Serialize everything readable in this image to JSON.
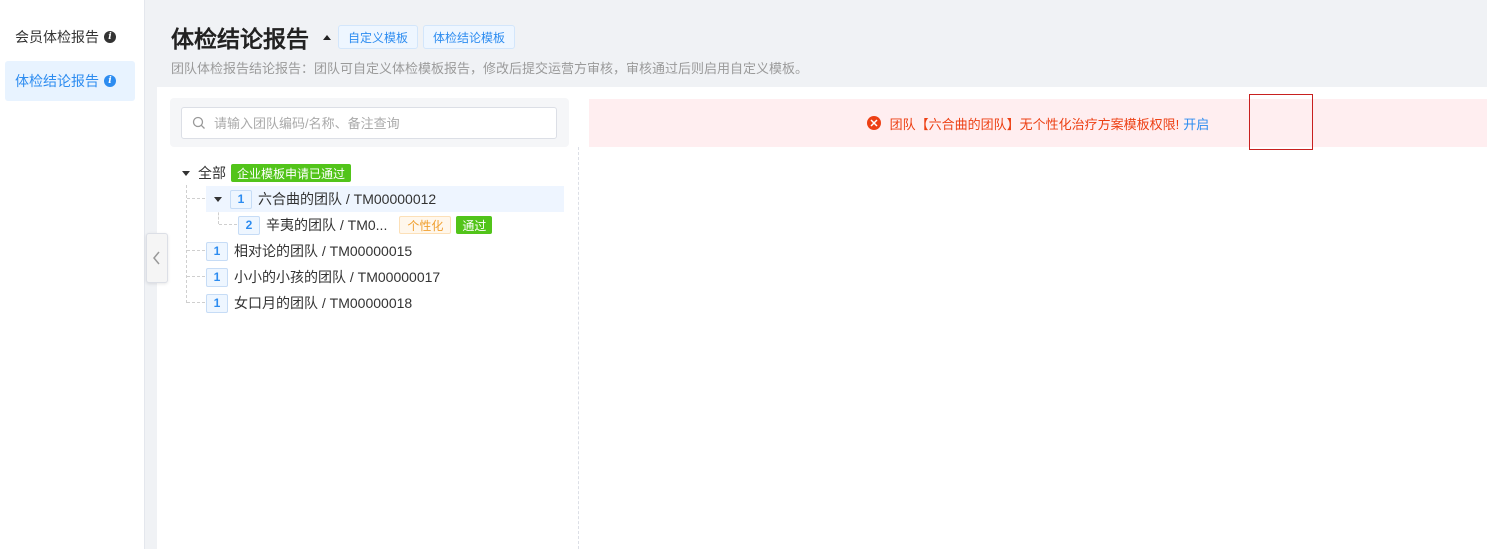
{
  "nav": {
    "items": [
      {
        "label": "会员体检报告",
        "icon": "info-icon",
        "active": false
      },
      {
        "label": "体检结论报告",
        "icon": "info-icon",
        "active": true
      }
    ]
  },
  "header": {
    "title": "体检结论报告",
    "tabs": [
      {
        "label": "自定义模板"
      },
      {
        "label": "体检结论模板"
      }
    ],
    "subtitle": "团队体检报告结论报告：团队可自定义体检模板报告，修改后提交运营方审核，审核通过后则启用自定义模板。"
  },
  "search": {
    "placeholder": "请输入团队编码/名称、备注查询",
    "value": ""
  },
  "tree": {
    "root": {
      "label": "全部",
      "badge": "企业模板申请已通过"
    },
    "nodes": [
      {
        "level": "1",
        "label": "六合曲的团队 / TM00000012",
        "expanded": true,
        "selected": true
      },
      {
        "level": "2",
        "label": "辛夷的团队 / TM0...",
        "tag": "个性化",
        "status": "通过"
      },
      {
        "level": "1",
        "label": "相对论的团队 / TM00000015"
      },
      {
        "level": "1",
        "label": "小小的小孩的团队 / TM00000017"
      },
      {
        "level": "1",
        "label": "女口月的团队 / TM00000018"
      }
    ]
  },
  "alert": {
    "message": "团队【六合曲的团队】无个性化治疗方案模板权限!",
    "action": "开启",
    "color": "#ed4014"
  },
  "colors": {
    "primary": "#2d8cf0",
    "success": "#52c41a",
    "warning": "#f0a030",
    "error": "#ed4014"
  }
}
